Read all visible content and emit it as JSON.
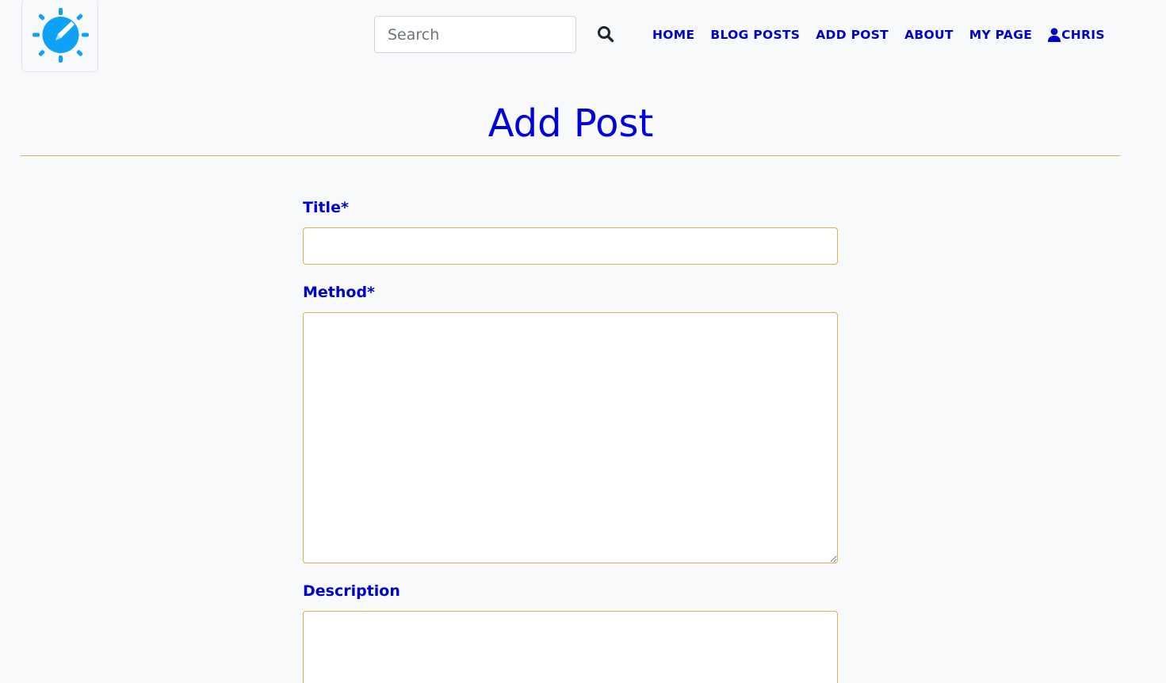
{
  "header": {
    "logo_icon": "gauge-pencil-icon",
    "logo_color": "#0da2f5",
    "search": {
      "placeholder": "Search",
      "value": "",
      "button_icon": "search-icon"
    },
    "nav": {
      "home": "HOME",
      "blog_posts": "BLOG POSTS",
      "add_post": "ADD POST",
      "about": "ABOUT",
      "my_page": "MY PAGE",
      "user": "CHRIS",
      "user_icon": "user-icon"
    }
  },
  "main": {
    "title": "Add Post",
    "form": {
      "title_label": "Title*",
      "title_value": "",
      "method_label": "Method*",
      "method_value": "",
      "description_label": "Description",
      "description_value": ""
    }
  },
  "colors": {
    "accent": "#0000cc",
    "border": "#d8b14f",
    "background": "#f8f9fa"
  }
}
